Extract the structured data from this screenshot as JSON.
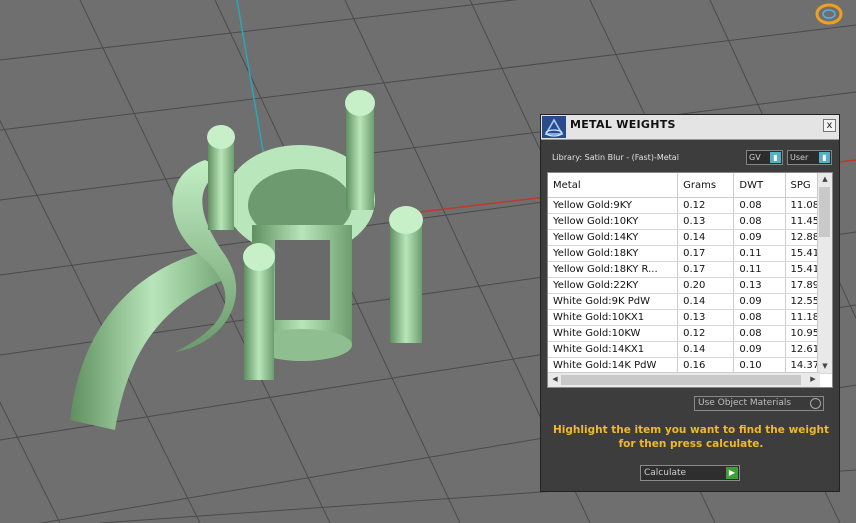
{
  "panel": {
    "title": "METAL WEIGHTS",
    "close_label": "x",
    "library_label": "Library: Satin Blur - (Fast)-Metal",
    "gv_select": "GV",
    "user_select": "User",
    "columns": [
      "Metal",
      "Grams",
      "DWT",
      "SPG"
    ],
    "rows": [
      {
        "metal": "Yellow Gold:9KY",
        "grams": "0.12",
        "dwt": "0.08",
        "spg": "11.08"
      },
      {
        "metal": "Yellow Gold:10KY",
        "grams": "0.13",
        "dwt": "0.08",
        "spg": "11.45"
      },
      {
        "metal": "Yellow Gold:14KY",
        "grams": "0.14",
        "dwt": "0.09",
        "spg": "12.88"
      },
      {
        "metal": "Yellow Gold:18KY",
        "grams": "0.17",
        "dwt": "0.11",
        "spg": "15.41"
      },
      {
        "metal": "Yellow Gold:18KY R...",
        "grams": "0.17",
        "dwt": "0.11",
        "spg": "15.41"
      },
      {
        "metal": "Yellow Gold:22KY",
        "grams": "0.20",
        "dwt": "0.13",
        "spg": "17.89"
      },
      {
        "metal": "White Gold:9K PdW",
        "grams": "0.14",
        "dwt": "0.09",
        "spg": "12.55"
      },
      {
        "metal": "White Gold:10KX1",
        "grams": "0.13",
        "dwt": "0.08",
        "spg": "11.18"
      },
      {
        "metal": "White Gold:10KW",
        "grams": "0.12",
        "dwt": "0.08",
        "spg": "10.95"
      },
      {
        "metal": "White Gold:14KX1",
        "grams": "0.14",
        "dwt": "0.09",
        "spg": "12.61"
      },
      {
        "metal": "White Gold:14K PdW",
        "grams": "0.16",
        "dwt": "0.10",
        "spg": "14.37"
      }
    ],
    "use_object_materials": "Use Object Materials",
    "help_text": "Highlight the item you want to find the weight for then press calculate.",
    "calculate_label": "Calculate"
  },
  "colors": {
    "viewport_bg": "#6f6f6f",
    "grid": "#4d4d4d",
    "model": "#a9d9ab",
    "help_text": "#f0b92c",
    "axis_x": "#c0392b",
    "axis_y": "#2aa7b5"
  }
}
